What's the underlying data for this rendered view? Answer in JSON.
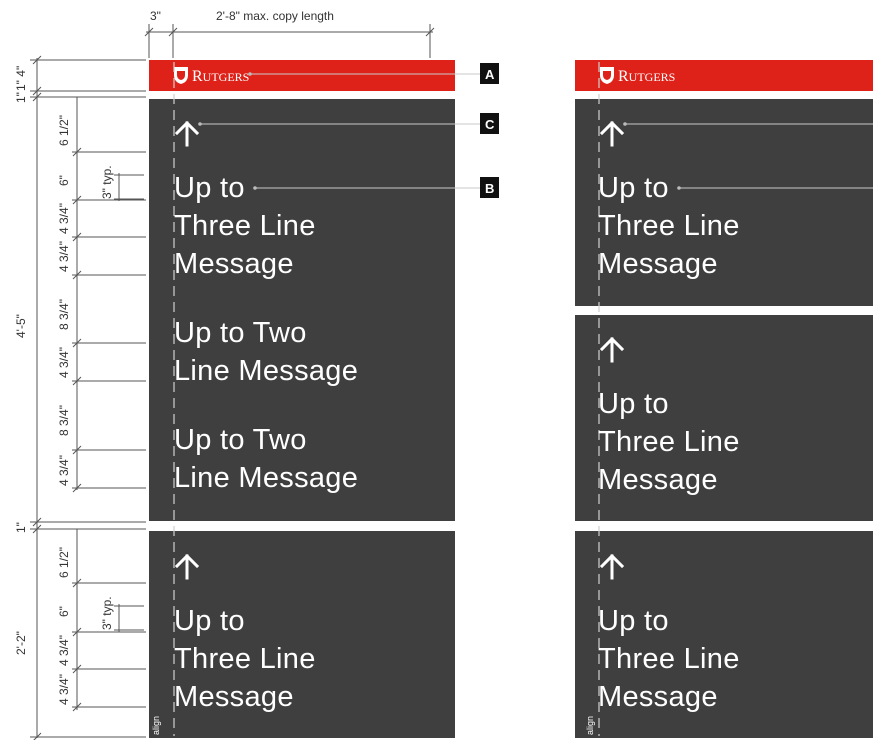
{
  "top_dimensions": {
    "margin": "3\"",
    "copy_length": "2'-8\" max. copy length"
  },
  "left_dimensions": {
    "header_height": "1\" 4\"",
    "gap1": "1\"",
    "section1_total": "4'-5\"",
    "section1_parts": [
      "6 1/2\"",
      "6\"",
      "4 3/4\"",
      "4 3/4\"",
      "8 3/4\"",
      "4 3/4\"",
      "8 3/4\"",
      "4 3/4\""
    ],
    "section1_typ": "3\" typ.",
    "gap2": "1\"",
    "section2_total": "2'-2\"",
    "section2_parts": [
      "6 1/2\"",
      "6\"",
      "4 3/4\"",
      "4 3/4\""
    ],
    "section2_typ": "3\" typ."
  },
  "brand": {
    "name_initial": "R",
    "name_rest": "UTGERS"
  },
  "callouts": {
    "a": "A",
    "b": "B",
    "c": "C"
  },
  "messages": {
    "three_line": [
      "Up to",
      "Three Line",
      "Message"
    ],
    "two_line": [
      "Up to Two",
      "Line Message"
    ]
  },
  "align_label": "align",
  "colors": {
    "panel": "#3f3f40",
    "brand_red": "#df2219",
    "text": "#ffffff"
  },
  "icons": {
    "arrow": "arrow-up-icon",
    "shield": "rutgers-shield-icon"
  }
}
